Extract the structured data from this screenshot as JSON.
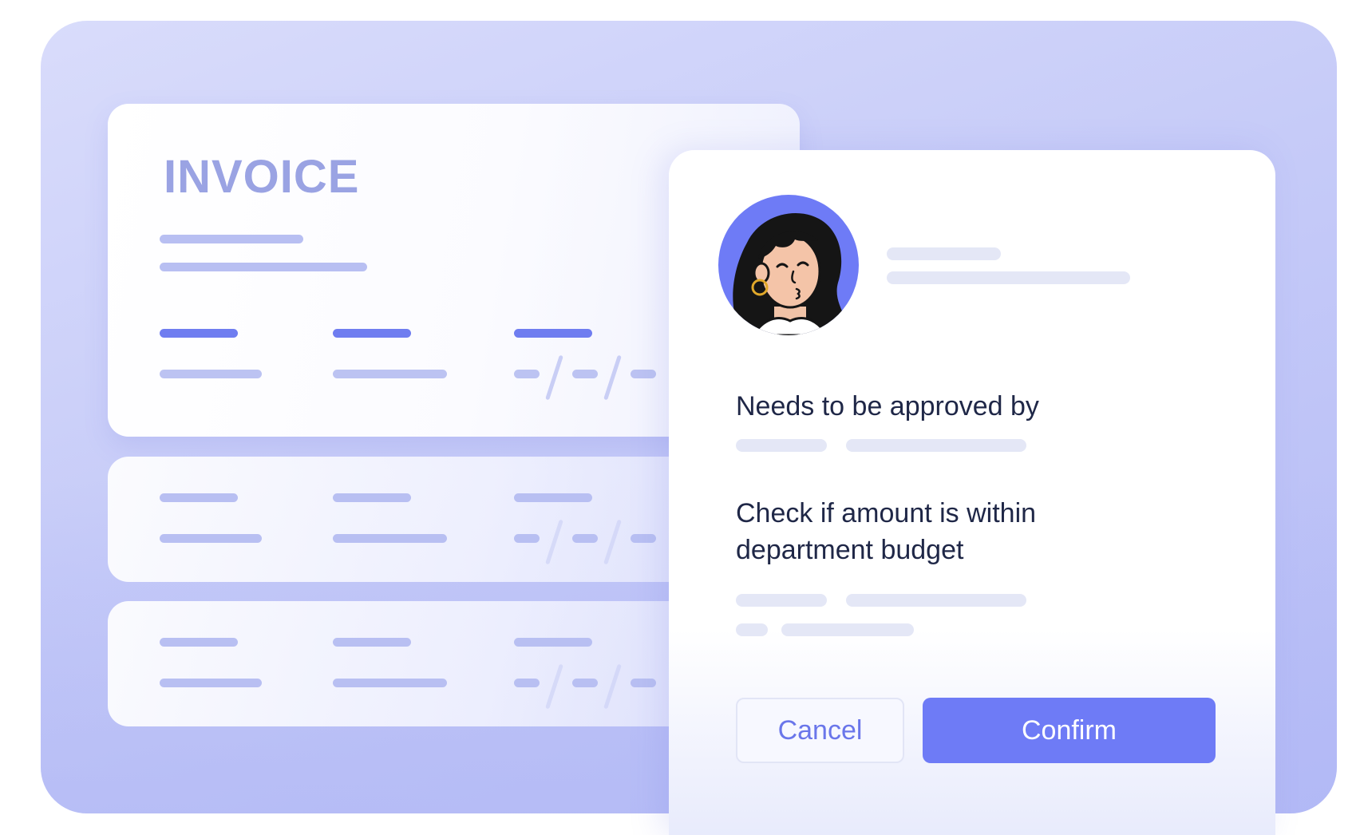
{
  "invoice": {
    "title": "INVOICE"
  },
  "dialog": {
    "approval_label": "Needs to be approved by",
    "check_label": "Check if amount is within department budget",
    "cancel_label": "Cancel",
    "confirm_label": "Confirm"
  },
  "colors": {
    "accent": "#6e7bf6",
    "backdrop": "#c6cbf8",
    "invoice_title": "#9aa3e3",
    "text_dark": "#1f2747"
  },
  "icons": {
    "avatar": "woman-avatar-icon"
  }
}
